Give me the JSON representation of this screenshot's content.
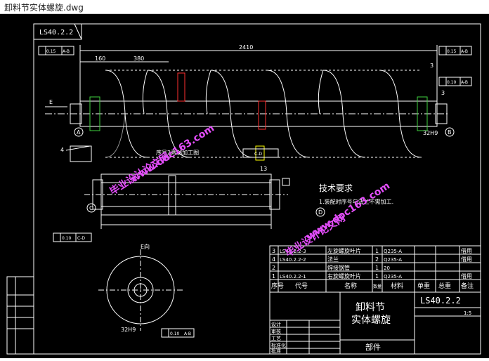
{
  "window": {
    "title": "卸料节实体螺旋.dwg"
  },
  "drawing": {
    "drawing_number": "LS40.2.2",
    "tol_015": "0.15",
    "tol_010": "0.10",
    "datum_ab": "A-B",
    "datum_cd": "C-D",
    "dim_total": "2410",
    "dim_160": "160",
    "dim_380": "380",
    "dim_3": "3",
    "dim_32h9": "32H9",
    "dim_13": "13",
    "label_e": "E",
    "view_e": "E向",
    "label_a": "A",
    "label_b": "B",
    "label_c": "C",
    "label_d": "D",
    "label_4": "4",
    "note_seq2": "序号2两端加工图",
    "tech_title": "技术要求",
    "tech_1": "1.装配时序号与法兰不需加工.",
    "bom": [
      {
        "no": "3",
        "code": "LS40.2.2-3",
        "name": "左旋螺旋叶片",
        "qty": "1",
        "material": "Q235-A",
        "ref": "借用"
      },
      {
        "no": "4",
        "code": "LS40.2.2-2",
        "name": "法兰",
        "qty": "2",
        "material": "Q235-A",
        "ref": "借用"
      },
      {
        "no": "2",
        "code": "",
        "name": "焊接钢管",
        "qty": "1",
        "material": "20",
        "ref": ""
      },
      {
        "no": "1",
        "code": "LS40.2.2-1",
        "name": "右旋螺旋叶片",
        "qty": "1",
        "material": "Q235-A",
        "ref": "借用"
      }
    ],
    "bom_header": {
      "no": "序号",
      "code": "代号",
      "name": "名称",
      "qty": "数量",
      "material": "材料",
      "unit": "单重",
      "total": "总重",
      "remark": "备注"
    },
    "title_name_1": "卸料节",
    "title_name_2": "实体螺旋",
    "title_part": "部件",
    "scale": "1:5",
    "designer": "设计",
    "checker": "审核",
    "process": "工艺",
    "approve": "批准",
    "standard": "标准化",
    "watermark_url": "www.doc163.com",
    "watermark_cn": "毕业设计论文网"
  }
}
